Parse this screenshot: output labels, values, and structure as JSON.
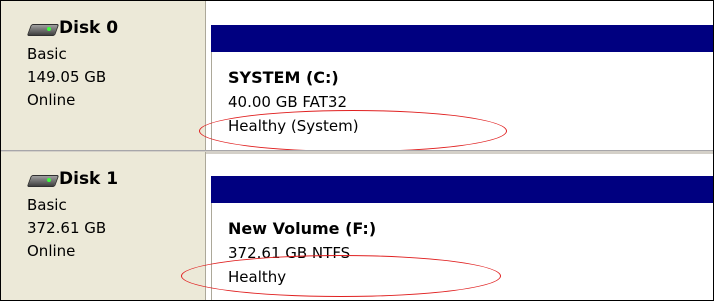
{
  "disks": [
    {
      "name": "Disk 0",
      "type": "Basic",
      "size": "149.05 GB",
      "status": "Online",
      "volume": {
        "name": "SYSTEM  (C:)",
        "size_fs": "40.00 GB FAT32",
        "status": "Healthy (System)"
      }
    },
    {
      "name": "Disk 1",
      "type": "Basic",
      "size": "372.61 GB",
      "status": "Online",
      "volume": {
        "name": "New Volume  (F:)",
        "size_fs": "372.61 GB NTFS",
        "status": "Healthy"
      }
    }
  ],
  "colors": {
    "volume_bar": "#000080",
    "disk_panel": "#ece9d8",
    "annotation_ellipse": "#e02020"
  },
  "icons": {
    "disk": "hard-disk-icon"
  }
}
